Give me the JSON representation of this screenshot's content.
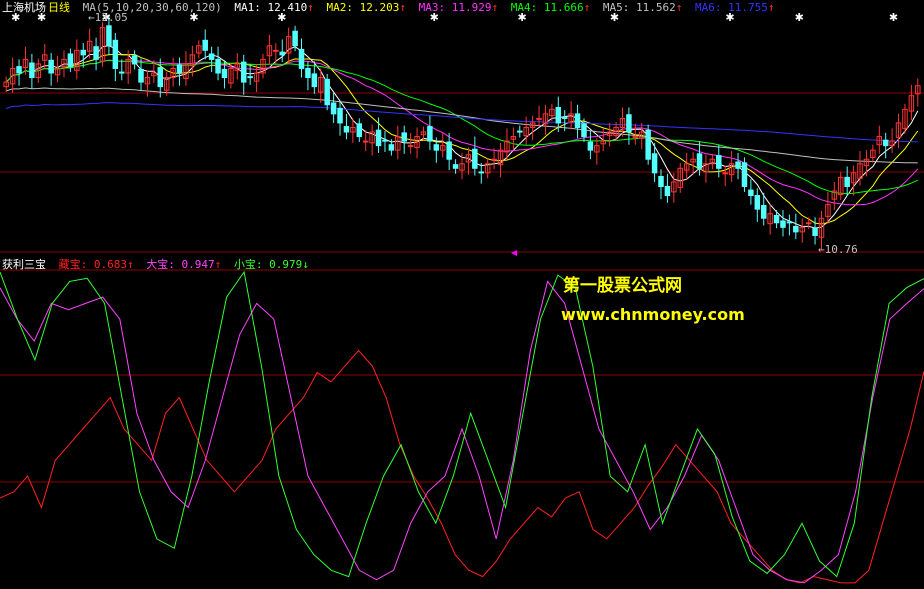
{
  "colors": {
    "background": "#000000",
    "grid": "#8b0000",
    "candle_up": "#ff3333",
    "candle_down": "#54ffff",
    "ma1": "#ffffff",
    "ma2": "#ffff00",
    "ma3": "#ff33ff",
    "ma4": "#00ff00",
    "ma5": "#c0c0c0",
    "ma6": "#3333ff",
    "red_line": "#ff2222",
    "green_line": "#33ff33",
    "magenta_line": "#ff44ff",
    "cursor_marker": "#ff00ff"
  },
  "main_header": {
    "stock_name": "上海机场",
    "period": "日线",
    "ma_spec": "MA(5,10,20,30,60,120)",
    "ma1_label": "MA1:",
    "ma1_value": "12.410",
    "ma2_label": "MA2:",
    "ma2_value": "12.203",
    "ma3_label": "MA3:",
    "ma3_value": "11.929",
    "ma4_label": "MA4:",
    "ma4_value": "11.666",
    "ma5_label": "MA5:",
    "ma5_value": "11.562",
    "ma6_label": "MA6:",
    "ma6_value": "11.755",
    "up_arrow": "↑"
  },
  "indicator_header": {
    "name": "获利三宝",
    "s1_label": "藏宝:",
    "s1_value": "0.683",
    "s2_label": "大宝:",
    "s2_value": "0.947",
    "s3_label": "小宝:",
    "s3_value": "0.979",
    "up_arrow": "↑",
    "down_arrow": "↓"
  },
  "price_labels": {
    "high": "13.05",
    "low": "10.76"
  },
  "watermark": {
    "line1": "第一股票公式网",
    "line2": "www.chnmoney.com"
  },
  "chart_data": [
    {
      "type": "line",
      "panel": "main",
      "price_range": [
        10.6,
        13.2
      ],
      "high_price": 13.05,
      "low_price": 10.76,
      "closes": [
        12.45,
        12.6,
        12.55,
        12.7,
        12.5,
        12.65,
        12.75,
        12.55,
        12.6,
        12.7,
        12.62,
        12.8,
        12.75,
        12.9,
        12.7,
        13.05,
        12.85,
        12.6,
        12.55,
        12.7,
        12.65,
        12.45,
        12.5,
        12.55,
        12.4,
        12.5,
        12.6,
        12.55,
        12.65,
        12.75,
        12.85,
        12.8,
        12.7,
        12.55,
        12.5,
        12.6,
        12.65,
        12.45,
        12.5,
        12.55,
        12.7,
        12.85,
        12.8,
        12.75,
        12.95,
        12.85,
        12.6,
        12.5,
        12.4,
        12.5,
        12.2,
        12.1,
        12.0,
        11.9,
        11.95,
        11.85,
        11.8,
        11.9,
        11.75,
        11.8,
        11.7,
        11.85,
        11.8,
        11.75,
        11.85,
        11.9,
        11.8,
        11.7,
        11.75,
        11.6,
        11.5,
        11.55,
        11.65,
        11.5,
        11.45,
        11.55,
        11.6,
        11.7,
        11.8,
        11.85,
        11.9,
        11.95,
        12.0,
        12.05,
        12.1,
        12.15,
        12.0,
        12.05,
        12.1,
        11.95,
        11.85,
        11.7,
        11.75,
        11.8,
        11.9,
        11.95,
        12.05,
        11.9,
        11.85,
        11.9,
        11.6,
        11.45,
        11.3,
        11.2,
        11.35,
        11.5,
        11.55,
        11.6,
        11.5,
        11.55,
        11.6,
        11.5,
        11.45,
        11.55,
        11.5,
        11.3,
        11.2,
        11.05,
        10.95,
        11.0,
        10.9,
        10.85,
        10.9,
        10.8,
        10.85,
        10.9,
        10.76,
        10.95,
        11.1,
        11.25,
        11.4,
        11.3,
        11.45,
        11.55,
        11.6,
        11.7,
        11.85,
        11.75,
        11.8,
        12.0,
        12.15,
        12.3,
        12.41
      ],
      "moving_averages": [
        {
          "name": "MA1",
          "start": 12.5,
          "end": 12.41
        },
        {
          "name": "MA2",
          "start": 12.45,
          "end": 12.203
        },
        {
          "name": "MA3",
          "start": 12.4,
          "end": 11.929
        },
        {
          "name": "MA4",
          "start": 12.35,
          "end": 11.666
        },
        {
          "name": "MA5",
          "start": 12.3,
          "end": 11.562
        },
        {
          "name": "MA6",
          "start": 12.0,
          "end": 11.755
        }
      ]
    },
    {
      "type": "line",
      "panel": "indicator",
      "ylim": [
        0,
        1
      ],
      "series": [
        {
          "name": "藏宝",
          "values": [
            0.28,
            0.3,
            0.35,
            0.25,
            0.4,
            0.45,
            0.5,
            0.55,
            0.6,
            0.5,
            0.45,
            0.4,
            0.55,
            0.6,
            0.5,
            0.4,
            0.35,
            0.3,
            0.35,
            0.4,
            0.5,
            0.55,
            0.6,
            0.68,
            0.65,
            0.7,
            0.75,
            0.7,
            0.6,
            0.45,
            0.35,
            0.28,
            0.2,
            0.1,
            0.05,
            0.03,
            0.08,
            0.15,
            0.2,
            0.25,
            0.22,
            0.28,
            0.3,
            0.18,
            0.15,
            0.2,
            0.25,
            0.32,
            0.38,
            0.45,
            0.4,
            0.35,
            0.3,
            0.2,
            0.15,
            0.1,
            0.05,
            0.02,
            0.01,
            0.03,
            0.02,
            0.01,
            0.01,
            0.05,
            0.2,
            0.35,
            0.5,
            0.683
          ]
        },
        {
          "name": "大宝",
          "values": [
            0.95,
            0.85,
            0.78,
            0.9,
            0.88,
            0.9,
            0.92,
            0.85,
            0.55,
            0.4,
            0.3,
            0.25,
            0.4,
            0.6,
            0.8,
            0.9,
            0.85,
            0.6,
            0.35,
            0.25,
            0.15,
            0.05,
            0.02,
            0.05,
            0.2,
            0.3,
            0.35,
            0.5,
            0.35,
            0.15,
            0.4,
            0.75,
            0.97,
            0.9,
            0.7,
            0.5,
            0.4,
            0.3,
            0.18,
            0.25,
            0.35,
            0.48,
            0.4,
            0.25,
            0.1,
            0.05,
            0.02,
            0.01,
            0.05,
            0.1,
            0.3,
            0.6,
            0.85,
            0.9,
            0.947
          ]
        },
        {
          "name": "小宝",
          "values": [
            1.0,
            0.85,
            0.72,
            0.9,
            0.97,
            0.98,
            0.9,
            0.6,
            0.3,
            0.15,
            0.12,
            0.35,
            0.65,
            0.92,
            1.0,
            0.7,
            0.35,
            0.18,
            0.1,
            0.05,
            0.03,
            0.2,
            0.35,
            0.45,
            0.3,
            0.2,
            0.35,
            0.55,
            0.4,
            0.25,
            0.55,
            0.85,
            0.99,
            0.95,
            0.7,
            0.35,
            0.3,
            0.45,
            0.2,
            0.35,
            0.5,
            0.42,
            0.22,
            0.08,
            0.04,
            0.1,
            0.2,
            0.08,
            0.03,
            0.2,
            0.6,
            0.9,
            0.95,
            0.979
          ]
        }
      ]
    }
  ]
}
